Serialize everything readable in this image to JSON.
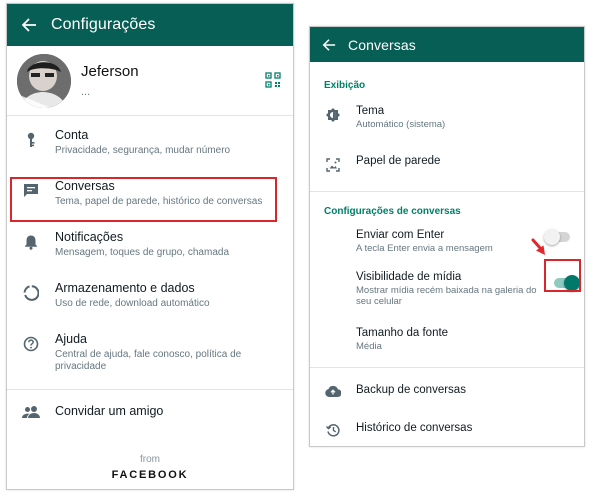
{
  "settings": {
    "title": "Configurações",
    "profile": {
      "name": "Jeferson",
      "about": "..."
    },
    "items": [
      {
        "title": "Conta",
        "subtitle": "Privacidade, segurança, mudar número"
      },
      {
        "title": "Conversas",
        "subtitle": "Tema, papel de parede, histórico de conversas"
      },
      {
        "title": "Notificações",
        "subtitle": "Mensagem, toques de grupo, chamada"
      },
      {
        "title": "Armazenamento e dados",
        "subtitle": "Uso de rede, download automático"
      },
      {
        "title": "Ajuda",
        "subtitle": "Central de ajuda, fale conosco, política de privacidade"
      }
    ],
    "invite": "Convidar um amigo",
    "footer": {
      "from": "from",
      "brand": "FACEBOOK"
    }
  },
  "chats": {
    "title": "Conversas",
    "section_display": "Exibição",
    "theme": {
      "title": "Tema",
      "subtitle": "Automático (sistema)"
    },
    "wallpaper": "Papel de parede",
    "section_chat_settings": "Configurações de conversas",
    "enter_send": {
      "title": "Enviar com Enter",
      "subtitle": "A tecla Enter envia a mensagem",
      "enabled": false
    },
    "media_visibility": {
      "title": "Visibilidade de mídia",
      "subtitle": "Mostrar mídia recém baixada na galeria do seu celular",
      "enabled": true
    },
    "font_size": {
      "title": "Tamanho da fonte",
      "subtitle": "Média"
    },
    "backup": "Backup de conversas",
    "history": "Histórico de conversas"
  },
  "colors": {
    "appbar": "#075e54",
    "accent": "#008069",
    "icon": "#54656f",
    "highlight": "#d9262c",
    "toggle_on": "#00796b"
  }
}
